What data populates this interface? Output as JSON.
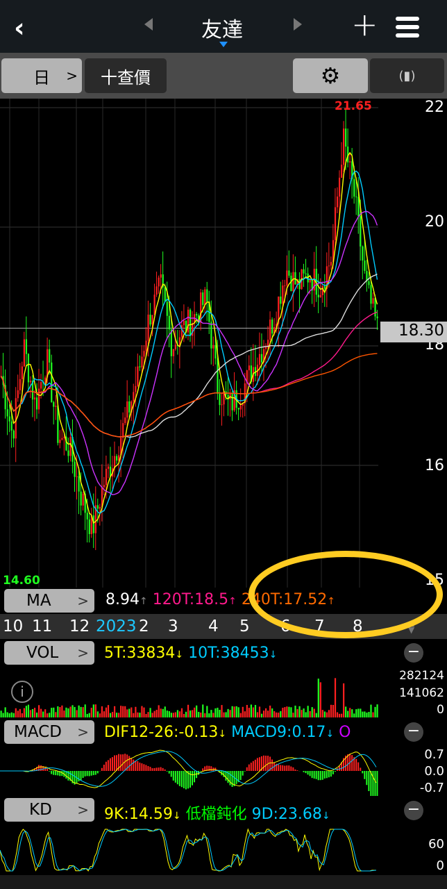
{
  "header": {
    "title": "友達",
    "back": "back-icon",
    "add": "+",
    "menu": "menu-icon"
  },
  "toolbar": {
    "period": "日",
    "query": "十查價",
    "settings": "gear-icon",
    "rotate": "rotate-icon"
  },
  "price_axis": {
    "labels": [
      "22",
      "20",
      "18",
      "16",
      "15"
    ],
    "current": "18.30",
    "high": "21.65",
    "low": "14.60"
  },
  "ma": {
    "label": "MA",
    "values": [
      {
        "text": "8.94",
        "color": "#ffffff"
      },
      {
        "text": "120T:18.5",
        "color": "#ff1a8c"
      },
      {
        "text": "240T:17.52",
        "color": "#ff6a00"
      }
    ]
  },
  "date_axis": [
    "10",
    "11",
    "12",
    "2023",
    "2",
    "3",
    "4",
    "5",
    "6",
    "7",
    "8"
  ],
  "vol": {
    "label": "VOL",
    "values": [
      {
        "text": "5T:33834",
        "color": "#ffff00"
      },
      {
        "text": "10T:38453",
        "color": "#00ccff"
      }
    ],
    "axis": [
      "282124",
      "141062",
      "0"
    ]
  },
  "macd": {
    "label": "MACD",
    "values": [
      {
        "text": "DIF12-26:-0.13",
        "color": "#ffff00"
      },
      {
        "text": "MACD9:0.17",
        "color": "#00ccff"
      },
      {
        "text": "O",
        "color": "#cc00ff"
      }
    ],
    "axis": [
      "0.7",
      "0.0",
      "-0.7"
    ]
  },
  "kd": {
    "label": "KD",
    "values": [
      {
        "text": "9K:14.59",
        "color": "#ffff00"
      },
      {
        "text": "低檔鈍化",
        "color": "#00ff00"
      },
      {
        "text": "9D:23.68",
        "color": "#00ccff"
      }
    ],
    "axis": [
      "60",
      "0"
    ]
  },
  "colors": {
    "up": "#ff2020",
    "down": "#20ff20",
    "ma5": "#ffff00",
    "ma10": "#00ccff",
    "ma20": "#cc33ff",
    "ma60": "#dddddd",
    "ma120": "#ff1a8c",
    "ma240": "#ff5500",
    "highlight": "#ffcc22"
  },
  "chart_data": {
    "type": "line",
    "ylim": [
      14.6,
      22
    ],
    "price_path": [
      17.5,
      16.5,
      18.0,
      17.0,
      17.8,
      16.5,
      16.3,
      15.5,
      14.9,
      15.7,
      16.2,
      16.8,
      17.5,
      18.5,
      19.0,
      18.0,
      18.3,
      18.5,
      18.8,
      17.3,
      17.0,
      17.2,
      17.6,
      18.0,
      18.5,
      19.3,
      19.0,
      19.2,
      19.0,
      19.5,
      21.5,
      20.5,
      19.0,
      18.3
    ]
  }
}
